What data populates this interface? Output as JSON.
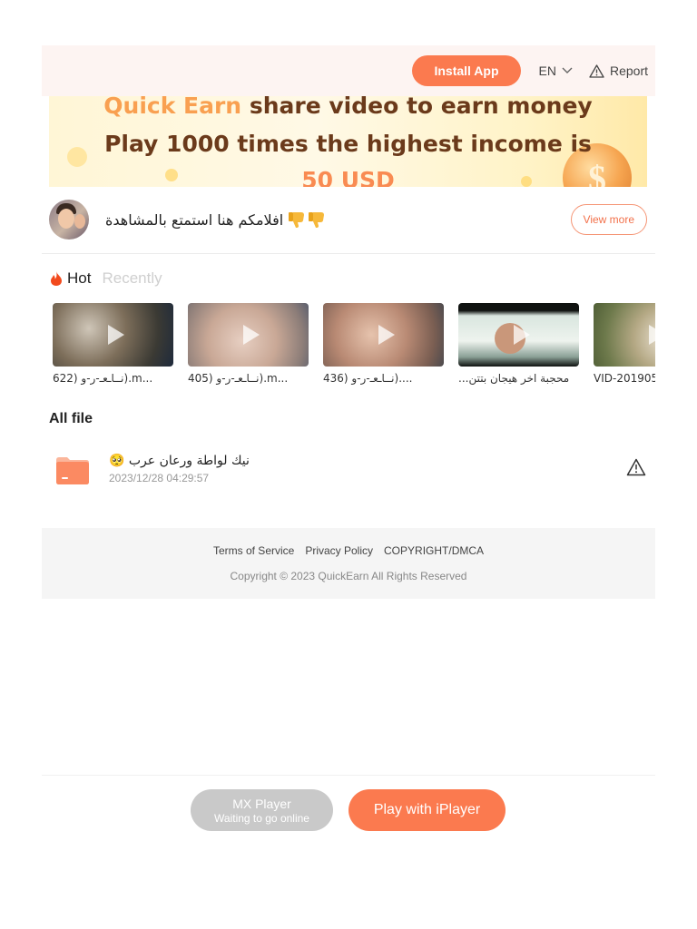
{
  "header": {
    "install_label": "Install App",
    "language": "EN",
    "report_label": "Report"
  },
  "banner": {
    "line1_highlight": "Quick Earn",
    "line1_rest": " share video to earn money",
    "line2": "Play 1000 times the highest income is",
    "line3": "50 USD",
    "coin_symbol": "$"
  },
  "profile": {
    "name": "افلامكم هنا استمتع بالمشاهدة",
    "view_more_label": "View more"
  },
  "tabs": {
    "hot_label": "Hot",
    "recent_label": "Recently"
  },
  "hot_videos": [
    {
      "title": "622) نــاـعـ-ر-و).m..."
    },
    {
      "title": "405) نــاـعـ-ر-و).m..."
    },
    {
      "title": "436) نــاـعـ-ر-و)...."
    },
    {
      "title": "محجبة اخر هيجان بتتن..."
    },
    {
      "title": "VID-201905..."
    }
  ],
  "all_file": {
    "section_title": "All file",
    "files": [
      {
        "name": "نيك لواطة ورعان عرب 🥺",
        "date": "2023/12/28 04:29:57"
      }
    ]
  },
  "footer": {
    "links": [
      "Terms of Service",
      "Privacy Policy",
      "COPYRIGHT/DMCA"
    ],
    "copyright": "Copyright © 2023 QuickEarn All Rights Reserved"
  },
  "bottom": {
    "mx_label": "MX Player",
    "mx_sub": "Waiting to go online",
    "iplayer_label": "Play with iPlayer"
  },
  "colors": {
    "accent": "#fb7a4f",
    "header_bg": "#fdf4f2",
    "footer_bg": "#f5f5f5",
    "disabled": "#c9c9c9"
  }
}
